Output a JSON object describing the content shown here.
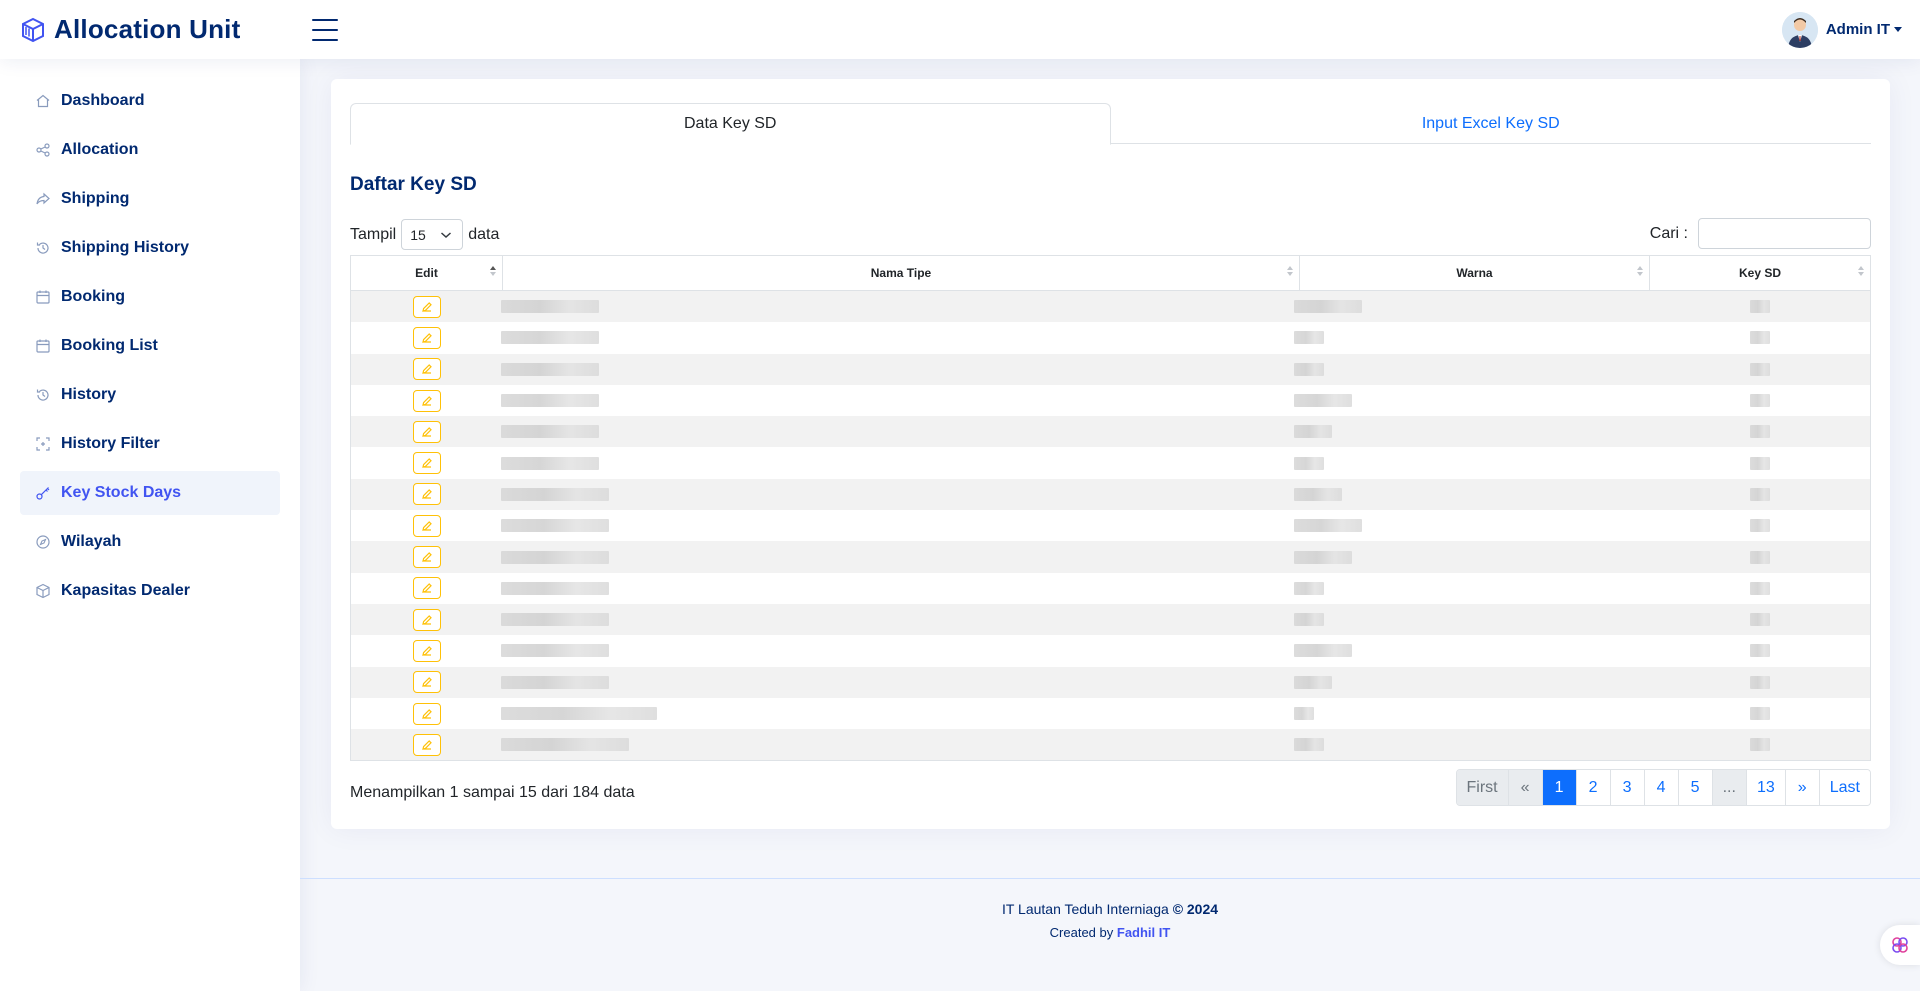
{
  "header": {
    "app_title": "Allocation Unit",
    "user_name": "Admin IT"
  },
  "sidebar": {
    "items": [
      {
        "label": "Dashboard",
        "icon": "house-icon"
      },
      {
        "label": "Allocation",
        "icon": "share-icon"
      },
      {
        "label": "Shipping",
        "icon": "forward-icon"
      },
      {
        "label": "Shipping History",
        "icon": "history-icon"
      },
      {
        "label": "Booking",
        "icon": "calendar-icon"
      },
      {
        "label": "Booking List",
        "icon": "calendar-icon"
      },
      {
        "label": "History",
        "icon": "history-icon"
      },
      {
        "label": "History Filter",
        "icon": "filter-icon"
      },
      {
        "label": "Key Stock Days",
        "icon": "key-icon",
        "active": true
      },
      {
        "label": "Wilayah",
        "icon": "compass-icon"
      },
      {
        "label": "Kapasitas Dealer",
        "icon": "box-icon"
      }
    ]
  },
  "tabs": [
    {
      "label": "Data Key SD",
      "active": true
    },
    {
      "label": "Input Excel Key SD",
      "active": false
    }
  ],
  "card": {
    "title": "Daftar Key SD",
    "show_label": "Tampil",
    "show_value": "15",
    "show_suffix": "data",
    "search_label": "Cari :",
    "search_value": ""
  },
  "table": {
    "columns": [
      "Edit",
      "Nama Tipe",
      "Warna",
      "Key SD"
    ],
    "row_count": 15
  },
  "footer_info": "Menampilkan 1 sampai 15 dari 184 data",
  "pagination": [
    "First",
    "«",
    "1",
    "2",
    "3",
    "4",
    "5",
    "...",
    "13",
    "»",
    "Last"
  ],
  "pagination_active": "1",
  "page_footer": {
    "company": "IT Lautan Teduh Interniaga",
    "copyright": "© 2024",
    "created_by": "Created by",
    "author": "Fadhil IT"
  },
  "colors": {
    "brand": "#012970",
    "accent": "#4154f1",
    "primary": "#0d6efd",
    "warning": "#ffc107"
  }
}
